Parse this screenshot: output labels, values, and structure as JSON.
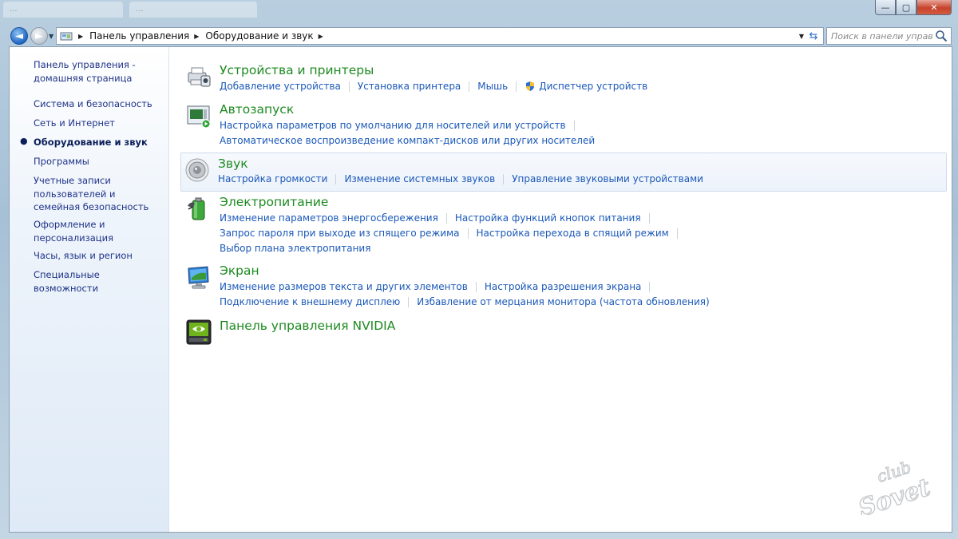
{
  "titlebar": {
    "ghost_tabs": [
      "...",
      "..."
    ],
    "buttons": {
      "minimize": "—",
      "maximize": "▢",
      "close": "✕"
    }
  },
  "nav": {
    "back_glyph": "◄",
    "forward_glyph": "►",
    "breadcrumb": [
      "Панель управления",
      "Оборудование и звук"
    ],
    "search_placeholder": "Поиск в панели управ..."
  },
  "sidebar": {
    "items": [
      {
        "label": "Панель управления - домашняя страница",
        "active": false
      },
      {
        "label": "Система и безопасность",
        "active": false
      },
      {
        "label": "Сеть и Интернет",
        "active": false
      },
      {
        "label": "Оборудование и звук",
        "active": true
      },
      {
        "label": "Программы",
        "active": false
      },
      {
        "label": "Учетные записи пользователей и семейная безопасность",
        "active": false
      },
      {
        "label": "Оформление и персонализация",
        "active": false
      },
      {
        "label": "Часы, язык и регион",
        "active": false
      },
      {
        "label": "Специальные возможности",
        "active": false
      }
    ]
  },
  "categories": [
    {
      "title": "Устройства и принтеры",
      "icon": "printer-icon",
      "rows": [
        [
          "Добавление устройства",
          "Установка принтера",
          "Мышь",
          "Диспетчер устройств"
        ]
      ]
    },
    {
      "title": "Автозапуск",
      "icon": "autoplay-icon",
      "rows": [
        [
          "Настройка параметров по умолчанию для носителей или устройств"
        ],
        [
          "Автоматическое воспроизведение компакт-дисков или других носителей"
        ]
      ]
    },
    {
      "title": "Звук",
      "icon": "speaker-icon",
      "rows": [
        [
          "Настройка громкости",
          "Изменение системных звуков",
          "Управление звуковыми устройствами"
        ]
      ]
    },
    {
      "title": "Электропитание",
      "icon": "battery-icon",
      "rows": [
        [
          "Изменение параметров энергосбережения",
          "Настройка функций кнопок питания"
        ],
        [
          "Запрос пароля при выходе из спящего режима",
          "Настройка перехода в спящий режим"
        ],
        [
          "Выбор плана электропитания"
        ]
      ]
    },
    {
      "title": "Экран",
      "icon": "monitor-icon",
      "rows": [
        [
          "Изменение размеров текста и других элементов",
          "Настройка разрешения экрана"
        ],
        [
          "Подключение к внешнему дисплею",
          "Избавление от мерцания монитора (частота обновления)"
        ]
      ]
    },
    {
      "title": "Панель управления NVIDIA",
      "icon": "nvidia-icon",
      "rows": []
    }
  ],
  "watermark": {
    "line1": "club",
    "line2": "Sovet"
  }
}
